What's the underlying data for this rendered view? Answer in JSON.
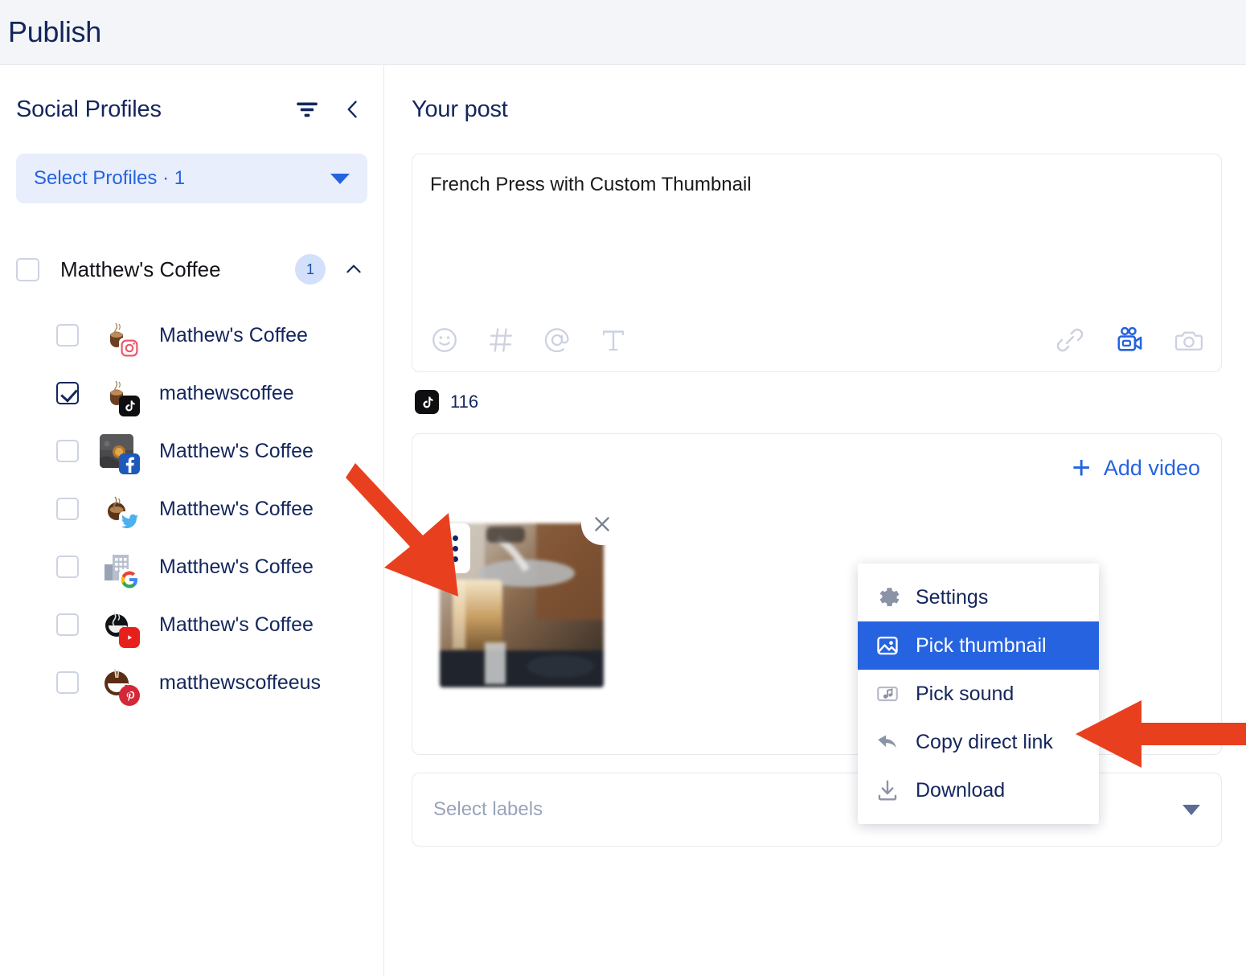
{
  "header": {
    "title": "Publish"
  },
  "sidebar": {
    "title": "Social Profiles",
    "filter_icon": "filter-icon",
    "collapse_icon": "chevron-left-icon",
    "select_profiles": {
      "label": "Select Profiles · 1",
      "caret_icon": "chevron-down-icon"
    },
    "group": {
      "name": "Matthew's Coffee",
      "count": "1",
      "expanded": true,
      "chevron_icon": "chevron-up-icon",
      "checked": false
    },
    "profiles": [
      {
        "name": "Mathew's Coffee",
        "network": "instagram",
        "checked": false
      },
      {
        "name": "mathewscoffee",
        "network": "tiktok",
        "checked": true
      },
      {
        "name": "Matthew's Coffee",
        "network": "facebook",
        "checked": false
      },
      {
        "name": "Matthew's Coffee",
        "network": "twitter",
        "checked": false
      },
      {
        "name": "Matthew's Coffee",
        "network": "google",
        "checked": false
      },
      {
        "name": "Matthew's Coffee",
        "network": "youtube",
        "checked": false
      },
      {
        "name": "matthewscoffeeus",
        "network": "pinterest",
        "checked": false
      }
    ]
  },
  "main": {
    "title": "Your post",
    "composer": {
      "text": "French Press with Custom Thumbnail",
      "toolbar_left": [
        {
          "icon": "emoji-icon",
          "state": "inactive"
        },
        {
          "icon": "hashtag-icon",
          "state": "inactive"
        },
        {
          "icon": "mention-icon",
          "state": "inactive"
        },
        {
          "icon": "text-format-icon",
          "state": "inactive"
        }
      ],
      "toolbar_right": [
        {
          "icon": "link-icon",
          "state": "inactive"
        },
        {
          "icon": "video-camera-icon",
          "state": "active"
        },
        {
          "icon": "camera-icon",
          "state": "inactive"
        }
      ]
    },
    "char_counter": {
      "network_icon": "tiktok-icon",
      "count": "116"
    },
    "media": {
      "add_video_label": "Add video",
      "add_video_icon": "plus-icon",
      "thumbnail_menu_icon": "kebab-menu-icon",
      "thumbnail_remove_icon": "close-icon"
    },
    "context_menu": [
      {
        "label": "Settings",
        "icon": "gear-icon",
        "active": false
      },
      {
        "label": "Pick thumbnail",
        "icon": "image-icon",
        "active": true
      },
      {
        "label": "Pick sound",
        "icon": "music-note-icon",
        "active": false
      },
      {
        "label": "Copy direct link",
        "icon": "reply-arrow-icon",
        "active": false
      },
      {
        "label": "Download",
        "icon": "download-icon",
        "active": false
      }
    ],
    "labels_select": {
      "placeholder": "Select labels",
      "caret_icon": "chevron-down-icon"
    }
  },
  "colors": {
    "accent_blue": "#2563e0",
    "navy_text": "#14265c",
    "header_bg": "#f4f5f9",
    "annotation_red": "#e8401f",
    "selected_menu_bg": "#2563e0"
  },
  "annotations": [
    {
      "name": "arrow-to-video-thumbnail",
      "color": "#e8401f",
      "direction": "down-right"
    },
    {
      "name": "arrow-to-pick-thumbnail",
      "color": "#e8401f",
      "direction": "left"
    }
  ]
}
